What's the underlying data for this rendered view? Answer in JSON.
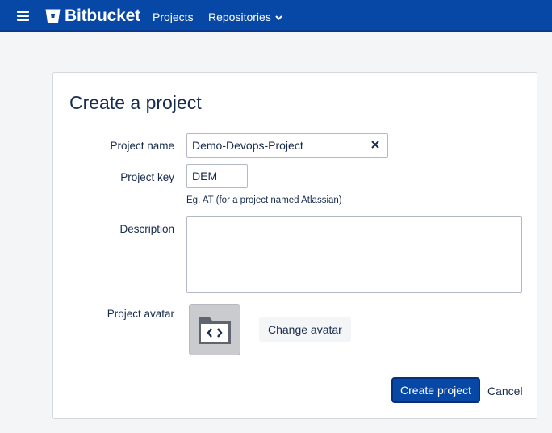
{
  "header": {
    "brand": "Bitbucket",
    "nav": {
      "projects": "Projects",
      "repositories": "Repositories"
    }
  },
  "form": {
    "title": "Create a project",
    "project_name": {
      "label": "Project name",
      "value": "Demo-Devops-Project"
    },
    "project_key": {
      "label": "Project key",
      "value": "DEM",
      "hint": "Eg. AT (for a project named Atlassian)"
    },
    "description": {
      "label": "Description",
      "value": ""
    },
    "avatar": {
      "label": "Project avatar",
      "change_label": "Change avatar"
    },
    "actions": {
      "create": "Create project",
      "cancel": "Cancel"
    }
  },
  "icons": {
    "menu": "hamburger-menu-icon",
    "logo": "bitbucket-logo-icon",
    "dropdown": "chevron-down-icon",
    "clear": "close-icon",
    "avatar": "code-folder-icon"
  },
  "colors": {
    "header_bg": "#0747a6",
    "primary_button": "#0747a6",
    "page_bg": "#f4f5f7",
    "text": "#172b4d"
  }
}
